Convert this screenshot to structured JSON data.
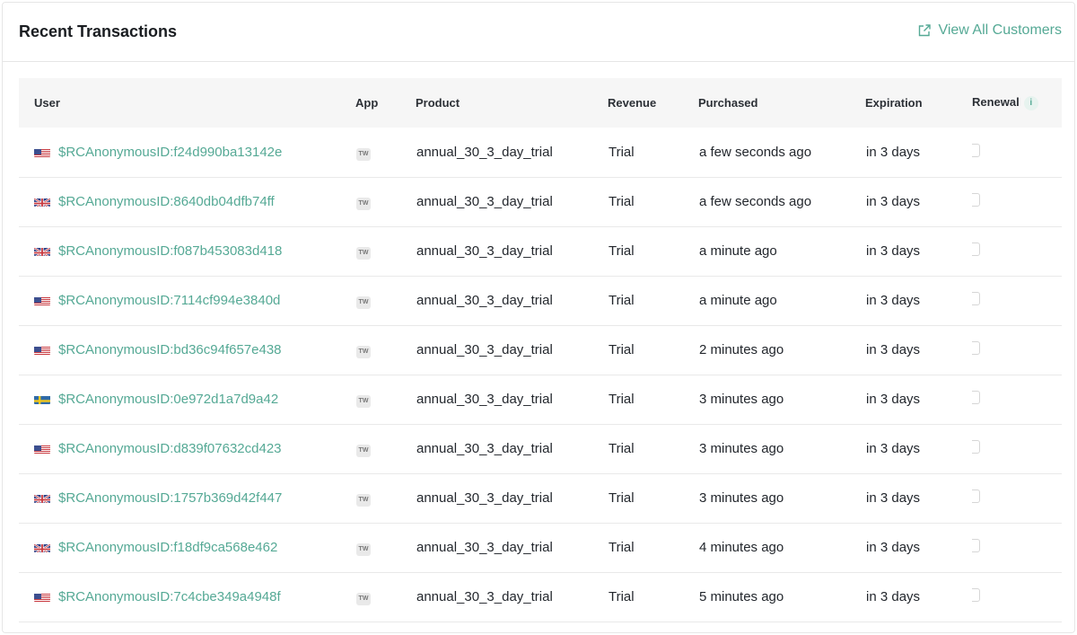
{
  "header": {
    "title": "Recent Transactions",
    "view_all_label": "View All Customers",
    "view_all_icon": "external-link-icon"
  },
  "colors": {
    "accent": "#55a995",
    "header_bg": "#f6f6f6"
  },
  "table": {
    "columns": [
      "User",
      "App",
      "Product",
      "Revenue",
      "Purchased",
      "Expiration",
      "Renewal"
    ],
    "rows": [
      {
        "flag": "us",
        "user": "$RCAnonymousID:f24d990ba13142e",
        "app": "TW",
        "product": "annual_30_3_day_trial",
        "revenue": "Trial",
        "purchased": "a few seconds ago",
        "expiration": "in 3 days",
        "renewal": false
      },
      {
        "flag": "gb",
        "user": "$RCAnonymousID:8640db04dfb74ff",
        "app": "TW",
        "product": "annual_30_3_day_trial",
        "revenue": "Trial",
        "purchased": "a few seconds ago",
        "expiration": "in 3 days",
        "renewal": false
      },
      {
        "flag": "gb",
        "user": "$RCAnonymousID:f087b453083d418",
        "app": "TW",
        "product": "annual_30_3_day_trial",
        "revenue": "Trial",
        "purchased": "a minute ago",
        "expiration": "in 3 days",
        "renewal": false
      },
      {
        "flag": "us",
        "user": "$RCAnonymousID:7114cf994e3840d",
        "app": "TW",
        "product": "annual_30_3_day_trial",
        "revenue": "Trial",
        "purchased": "a minute ago",
        "expiration": "in 3 days",
        "renewal": false
      },
      {
        "flag": "us",
        "user": "$RCAnonymousID:bd36c94f657e438",
        "app": "TW",
        "product": "annual_30_3_day_trial",
        "revenue": "Trial",
        "purchased": "2 minutes ago",
        "expiration": "in 3 days",
        "renewal": false
      },
      {
        "flag": "se",
        "user": "$RCAnonymousID:0e972d1a7d9a42",
        "app": "TW",
        "product": "annual_30_3_day_trial",
        "revenue": "Trial",
        "purchased": "3 minutes ago",
        "expiration": "in 3 days",
        "renewal": false
      },
      {
        "flag": "us",
        "user": "$RCAnonymousID:d839f07632cd423",
        "app": "TW",
        "product": "annual_30_3_day_trial",
        "revenue": "Trial",
        "purchased": "3 minutes ago",
        "expiration": "in 3 days",
        "renewal": false
      },
      {
        "flag": "gb",
        "user": "$RCAnonymousID:1757b369d42f447",
        "app": "TW",
        "product": "annual_30_3_day_trial",
        "revenue": "Trial",
        "purchased": "3 minutes ago",
        "expiration": "in 3 days",
        "renewal": false
      },
      {
        "flag": "gb",
        "user": "$RCAnonymousID:f18df9ca568e462",
        "app": "TW",
        "product": "annual_30_3_day_trial",
        "revenue": "Trial",
        "purchased": "4 minutes ago",
        "expiration": "in 3 days",
        "renewal": false
      },
      {
        "flag": "us",
        "user": "$RCAnonymousID:7c4cbe349a4948f",
        "app": "TW",
        "product": "annual_30_3_day_trial",
        "revenue": "Trial",
        "purchased": "5 minutes ago",
        "expiration": "in 3 days",
        "renewal": false
      }
    ]
  }
}
